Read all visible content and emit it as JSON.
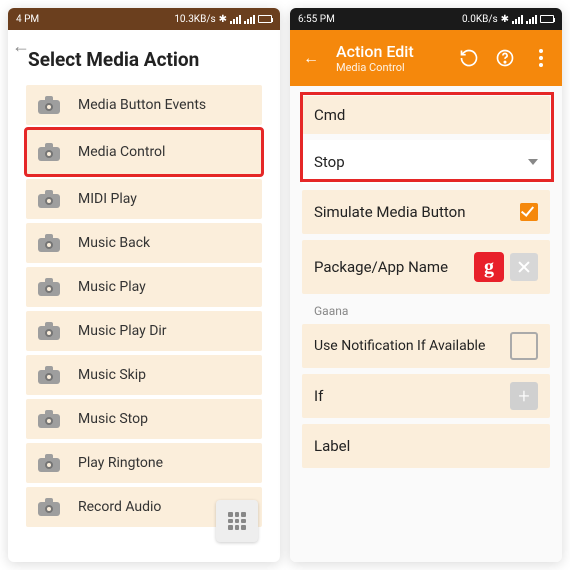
{
  "left": {
    "status_time": "4 PM",
    "status_net": "10.3KB/s",
    "title": "Select Media Action",
    "items": [
      {
        "label": "Media Button Events"
      },
      {
        "label": "Media Control"
      },
      {
        "label": "MIDI Play"
      },
      {
        "label": "Music Back"
      },
      {
        "label": "Music Play"
      },
      {
        "label": "Music Play Dir"
      },
      {
        "label": "Music Skip"
      },
      {
        "label": "Music Stop"
      },
      {
        "label": "Play Ringtone"
      },
      {
        "label": "Record Audio"
      }
    ]
  },
  "right": {
    "status_time": "6:55 PM",
    "status_net": "0.0KB/s",
    "appbar": {
      "title": "Action Edit",
      "sub": "Media Control"
    },
    "cmd_label": "Cmd",
    "cmd_value": "Stop",
    "simulate_label": "Simulate Media Button",
    "package_label": "Package/App Name",
    "package_badge": "g",
    "package_value_small": "Gaana",
    "notif_label": "Use Notification If Available",
    "if_label": "If",
    "label_label": "Label"
  }
}
